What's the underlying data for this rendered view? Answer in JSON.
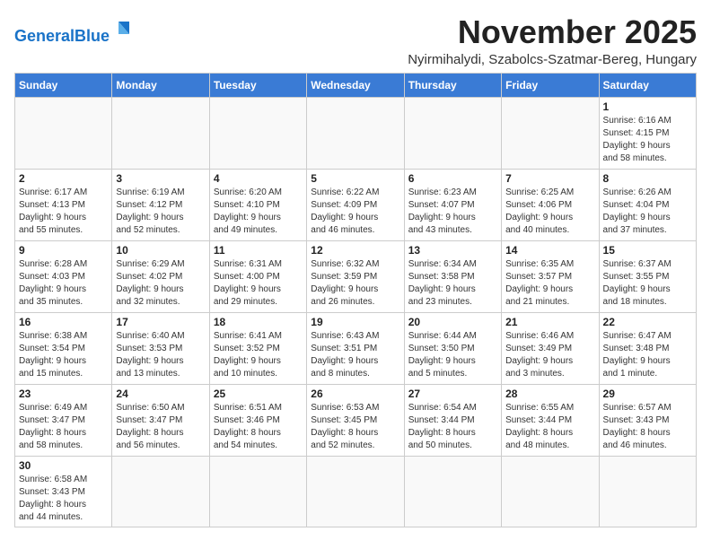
{
  "header": {
    "logo_general": "General",
    "logo_blue": "Blue",
    "month_title": "November 2025",
    "location": "Nyirmihalydi, Szabolcs-Szatmar-Bereg, Hungary"
  },
  "days_of_week": [
    "Sunday",
    "Monday",
    "Tuesday",
    "Wednesday",
    "Thursday",
    "Friday",
    "Saturday"
  ],
  "weeks": [
    [
      {
        "day": "",
        "info": ""
      },
      {
        "day": "",
        "info": ""
      },
      {
        "day": "",
        "info": ""
      },
      {
        "day": "",
        "info": ""
      },
      {
        "day": "",
        "info": ""
      },
      {
        "day": "",
        "info": ""
      },
      {
        "day": "1",
        "info": "Sunrise: 6:16 AM\nSunset: 4:15 PM\nDaylight: 9 hours\nand 58 minutes."
      }
    ],
    [
      {
        "day": "2",
        "info": "Sunrise: 6:17 AM\nSunset: 4:13 PM\nDaylight: 9 hours\nand 55 minutes."
      },
      {
        "day": "3",
        "info": "Sunrise: 6:19 AM\nSunset: 4:12 PM\nDaylight: 9 hours\nand 52 minutes."
      },
      {
        "day": "4",
        "info": "Sunrise: 6:20 AM\nSunset: 4:10 PM\nDaylight: 9 hours\nand 49 minutes."
      },
      {
        "day": "5",
        "info": "Sunrise: 6:22 AM\nSunset: 4:09 PM\nDaylight: 9 hours\nand 46 minutes."
      },
      {
        "day": "6",
        "info": "Sunrise: 6:23 AM\nSunset: 4:07 PM\nDaylight: 9 hours\nand 43 minutes."
      },
      {
        "day": "7",
        "info": "Sunrise: 6:25 AM\nSunset: 4:06 PM\nDaylight: 9 hours\nand 40 minutes."
      },
      {
        "day": "8",
        "info": "Sunrise: 6:26 AM\nSunset: 4:04 PM\nDaylight: 9 hours\nand 37 minutes."
      }
    ],
    [
      {
        "day": "9",
        "info": "Sunrise: 6:28 AM\nSunset: 4:03 PM\nDaylight: 9 hours\nand 35 minutes."
      },
      {
        "day": "10",
        "info": "Sunrise: 6:29 AM\nSunset: 4:02 PM\nDaylight: 9 hours\nand 32 minutes."
      },
      {
        "day": "11",
        "info": "Sunrise: 6:31 AM\nSunset: 4:00 PM\nDaylight: 9 hours\nand 29 minutes."
      },
      {
        "day": "12",
        "info": "Sunrise: 6:32 AM\nSunset: 3:59 PM\nDaylight: 9 hours\nand 26 minutes."
      },
      {
        "day": "13",
        "info": "Sunrise: 6:34 AM\nSunset: 3:58 PM\nDaylight: 9 hours\nand 23 minutes."
      },
      {
        "day": "14",
        "info": "Sunrise: 6:35 AM\nSunset: 3:57 PM\nDaylight: 9 hours\nand 21 minutes."
      },
      {
        "day": "15",
        "info": "Sunrise: 6:37 AM\nSunset: 3:55 PM\nDaylight: 9 hours\nand 18 minutes."
      }
    ],
    [
      {
        "day": "16",
        "info": "Sunrise: 6:38 AM\nSunset: 3:54 PM\nDaylight: 9 hours\nand 15 minutes."
      },
      {
        "day": "17",
        "info": "Sunrise: 6:40 AM\nSunset: 3:53 PM\nDaylight: 9 hours\nand 13 minutes."
      },
      {
        "day": "18",
        "info": "Sunrise: 6:41 AM\nSunset: 3:52 PM\nDaylight: 9 hours\nand 10 minutes."
      },
      {
        "day": "19",
        "info": "Sunrise: 6:43 AM\nSunset: 3:51 PM\nDaylight: 9 hours\nand 8 minutes."
      },
      {
        "day": "20",
        "info": "Sunrise: 6:44 AM\nSunset: 3:50 PM\nDaylight: 9 hours\nand 5 minutes."
      },
      {
        "day": "21",
        "info": "Sunrise: 6:46 AM\nSunset: 3:49 PM\nDaylight: 9 hours\nand 3 minutes."
      },
      {
        "day": "22",
        "info": "Sunrise: 6:47 AM\nSunset: 3:48 PM\nDaylight: 9 hours\nand 1 minute."
      }
    ],
    [
      {
        "day": "23",
        "info": "Sunrise: 6:49 AM\nSunset: 3:47 PM\nDaylight: 8 hours\nand 58 minutes."
      },
      {
        "day": "24",
        "info": "Sunrise: 6:50 AM\nSunset: 3:47 PM\nDaylight: 8 hours\nand 56 minutes."
      },
      {
        "day": "25",
        "info": "Sunrise: 6:51 AM\nSunset: 3:46 PM\nDaylight: 8 hours\nand 54 minutes."
      },
      {
        "day": "26",
        "info": "Sunrise: 6:53 AM\nSunset: 3:45 PM\nDaylight: 8 hours\nand 52 minutes."
      },
      {
        "day": "27",
        "info": "Sunrise: 6:54 AM\nSunset: 3:44 PM\nDaylight: 8 hours\nand 50 minutes."
      },
      {
        "day": "28",
        "info": "Sunrise: 6:55 AM\nSunset: 3:44 PM\nDaylight: 8 hours\nand 48 minutes."
      },
      {
        "day": "29",
        "info": "Sunrise: 6:57 AM\nSunset: 3:43 PM\nDaylight: 8 hours\nand 46 minutes."
      }
    ],
    [
      {
        "day": "30",
        "info": "Sunrise: 6:58 AM\nSunset: 3:43 PM\nDaylight: 8 hours\nand 44 minutes."
      },
      {
        "day": "",
        "info": ""
      },
      {
        "day": "",
        "info": ""
      },
      {
        "day": "",
        "info": ""
      },
      {
        "day": "",
        "info": ""
      },
      {
        "day": "",
        "info": ""
      },
      {
        "day": "",
        "info": ""
      }
    ]
  ]
}
